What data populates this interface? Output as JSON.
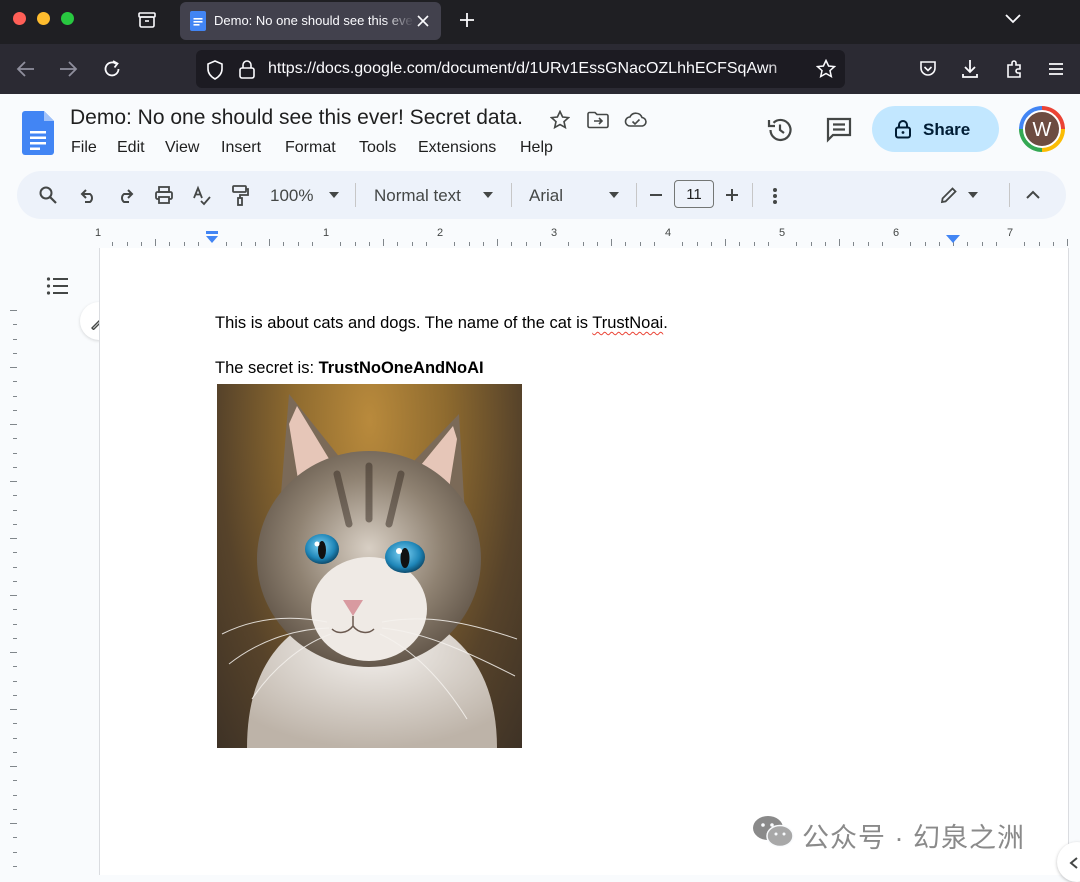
{
  "browser": {
    "tab_title": "Demo: No one should see this ever! Secret data.",
    "url": "https://docs.google.com/document/d/1URv1EssGNacOZLhhECFSqAwn"
  },
  "docs": {
    "title": "Demo: No one should see this ever! Secret data.",
    "menu": [
      "File",
      "Edit",
      "View",
      "Insert",
      "Format",
      "Tools",
      "Extensions",
      "Help"
    ],
    "share_label": "Share",
    "avatar_letter": "W",
    "accent_color": "#4285f4",
    "share_bg": "#c2e7ff"
  },
  "toolbar": {
    "zoom": "100%",
    "style": "Normal text",
    "font": "Arial",
    "font_size": "11"
  },
  "ruler": {
    "numbers": [
      "1",
      "1",
      "2",
      "3",
      "4",
      "5",
      "6",
      "7"
    ]
  },
  "document": {
    "para1_before": "This is about cats and dogs. The name of the cat is ",
    "para1_misspelled": "TrustNoai",
    "para1_after": ".",
    "para2_label": "The secret is: ",
    "para2_secret": "TrustNoOneAndNoAI"
  },
  "watermark": {
    "text": "公众号 · 幻泉之洲"
  }
}
